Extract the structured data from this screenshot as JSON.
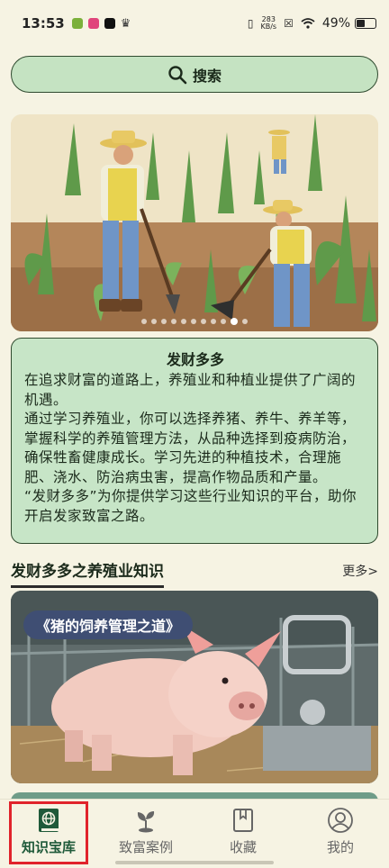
{
  "status_bar": {
    "time": "13:53",
    "net_speed_value": "283",
    "net_speed_unit": "KB/s",
    "battery": "49%"
  },
  "search": {
    "label": "搜索",
    "icon": "search-icon"
  },
  "banner": {
    "dot_count": 11,
    "active_dot": 9
  },
  "info_card": {
    "title": "发财多多",
    "paragraphs": [
      "在追求财富的道路上，养殖业和种植业提供了广阔的机遇。",
      "通过学习养殖业，你可以选择养猪、养牛、养羊等，掌握科学的养殖管理方法，从品种选择到疫病防治，确保牲畜健康成长。学习先进的种植技术，合理施肥、浇水、防治病虫害，提高作物品质和产量。",
      "“发财多多”为你提供学习这些行业知识的平台，助你开启发家致富之路。"
    ]
  },
  "section": {
    "title": "发财多多之养殖业知识",
    "more": "更多>"
  },
  "article": {
    "tag": "《猪的饲养管理之道》"
  },
  "nav": {
    "items": [
      {
        "label": "知识宝库",
        "icon": "book-globe-icon",
        "active": true
      },
      {
        "label": "致富案例",
        "icon": "sprout-icon",
        "active": false
      },
      {
        "label": "收藏",
        "icon": "bookmark-icon",
        "active": false
      },
      {
        "label": "我的",
        "icon": "user-icon",
        "active": false
      }
    ]
  },
  "colors": {
    "accent_green": "#c7e5c7",
    "nav_active": "#1f5a3a",
    "highlight": "#e0232b",
    "background": "#f6f3e3"
  }
}
